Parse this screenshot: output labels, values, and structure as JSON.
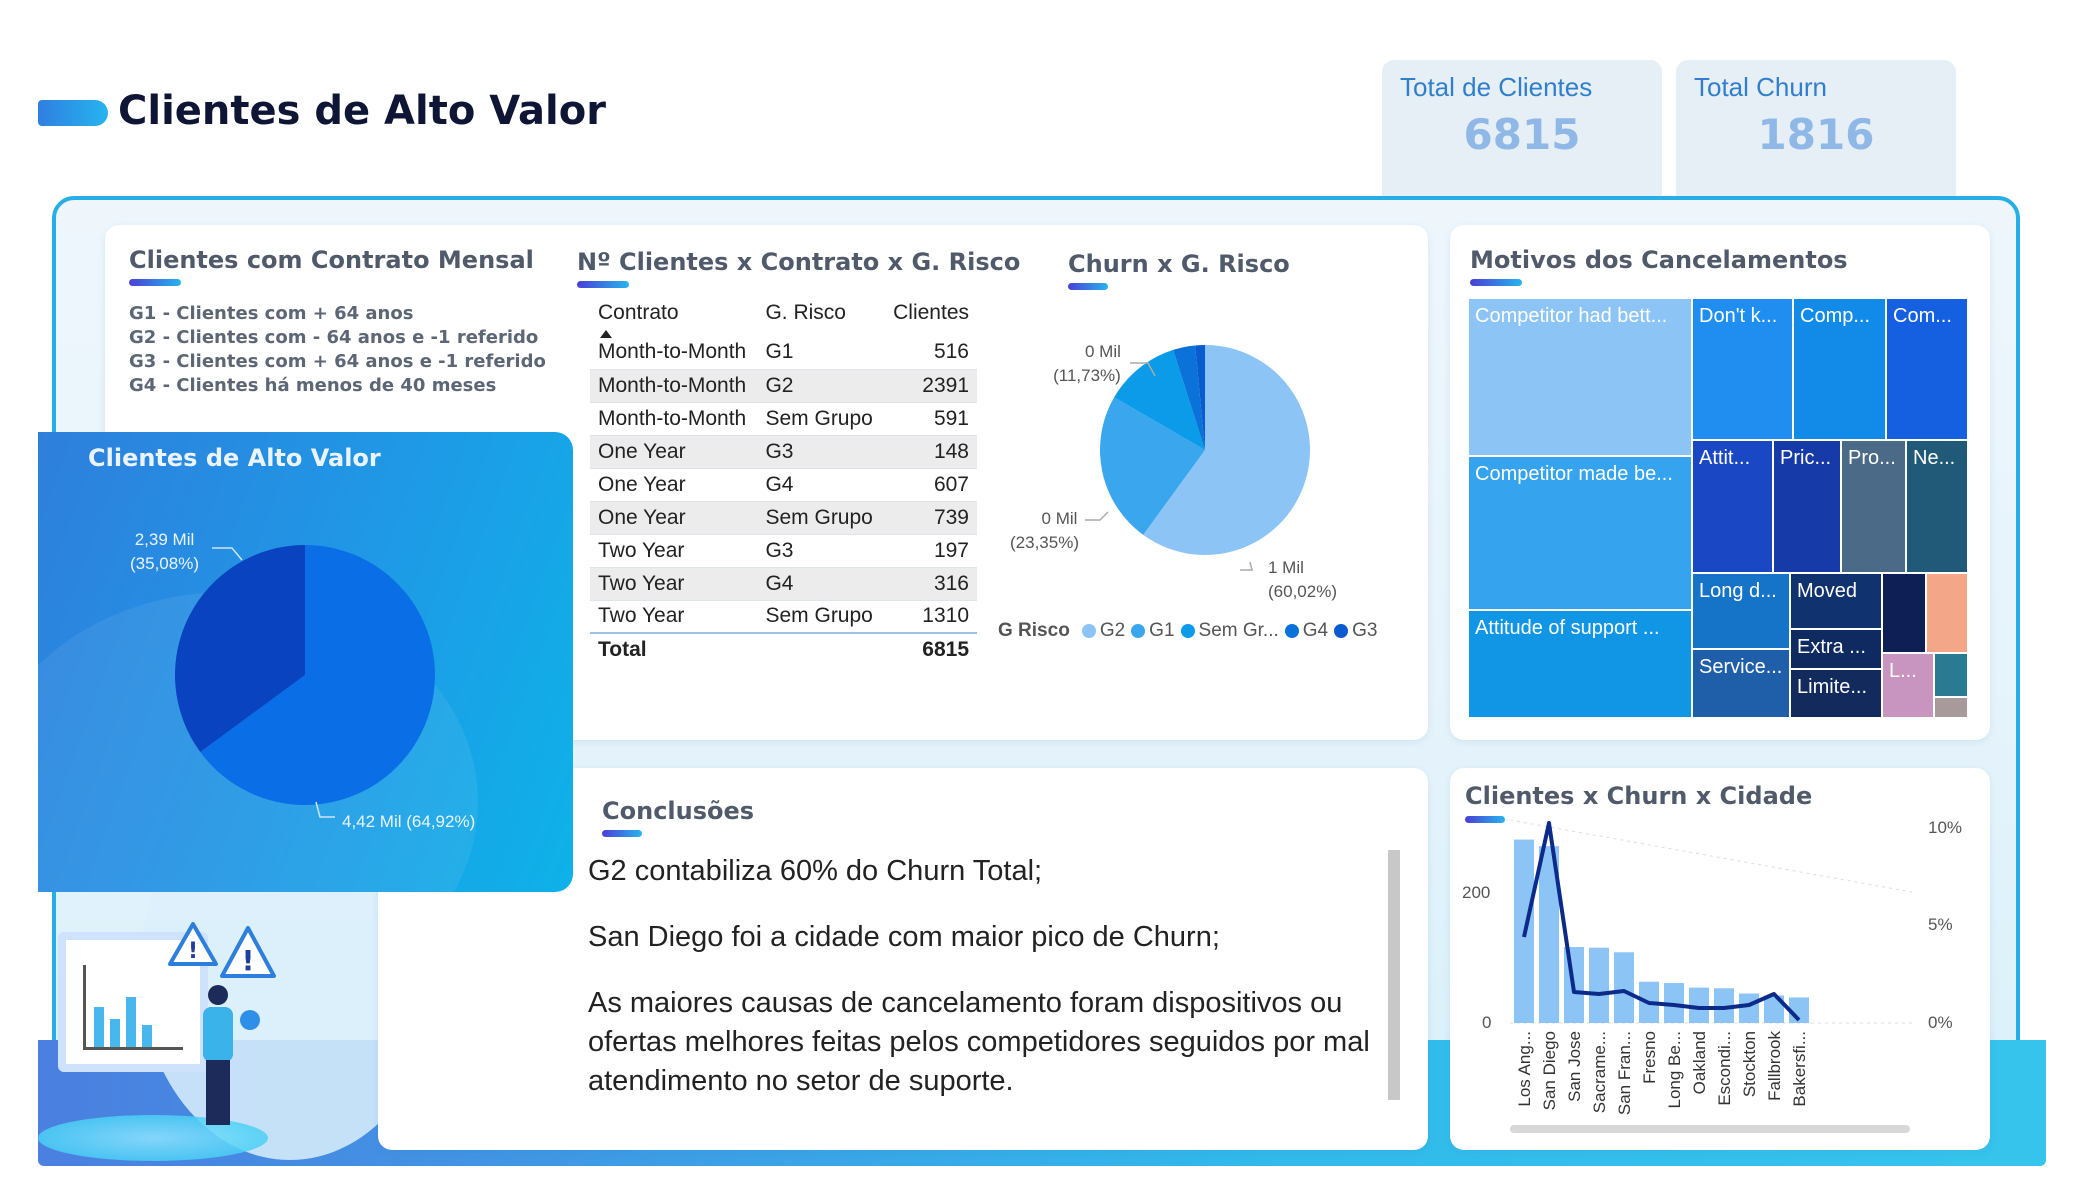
{
  "page": {
    "title": "Clientes de Alto Valor"
  },
  "kpis": [
    {
      "label": "Total de Clientes",
      "value": "6815"
    },
    {
      "label": "Total Churn",
      "value": "1816"
    }
  ],
  "mensal": {
    "title": "Clientes com Contrato Mensal",
    "groups": [
      "G1 - Clientes com + 64 anos",
      "G2 - Clientes com - 64 anos e -1 referido",
      "G3 - Clientes com + 64 anos e -1 referido",
      "G4 - Clientes há menos de 40 meses"
    ]
  },
  "alto_valor": {
    "title": "Clientes de Alto Valor",
    "label_a": "2,39 Mil",
    "label_a_pct": "(35,08%)",
    "label_b": "4,42 Mil (64,92%)"
  },
  "tabela": {
    "title": "Nº Clientes x Contrato x G. Risco",
    "headers": [
      "Contrato",
      "G. Risco",
      "Clientes"
    ],
    "rows": [
      [
        "Month-to-Month",
        "G1",
        "516"
      ],
      [
        "Month-to-Month",
        "G2",
        "2391"
      ],
      [
        "Month-to-Month",
        "Sem Grupo",
        "591"
      ],
      [
        "One Year",
        "G3",
        "148"
      ],
      [
        "One Year",
        "G4",
        "607"
      ],
      [
        "One Year",
        "Sem Grupo",
        "739"
      ],
      [
        "Two Year",
        "G3",
        "197"
      ],
      [
        "Two Year",
        "G4",
        "316"
      ],
      [
        "Two Year",
        "Sem Grupo",
        "1310"
      ]
    ],
    "total_label": "Total",
    "total_value": "6815"
  },
  "churn_risco": {
    "title": "Churn x G. Risco",
    "label_top": "0 Mil",
    "label_top_pct": "(11,73%)",
    "label_left": "0 Mil",
    "label_left_pct": "(23,35%)",
    "label_right": "1 Mil",
    "label_right_pct": "(60,02%)",
    "legend_title": "G Risco",
    "legend": [
      "G2",
      "G1",
      "Sem Gr...",
      "G4",
      "G3"
    ]
  },
  "motivos": {
    "title": "Motivos dos Cancelamentos",
    "cells": [
      "Competitor had bett...",
      "Don't k...",
      "Comp...",
      "Com...",
      "Competitor made be...",
      "Attit...",
      "Pric...",
      "Pro...",
      "Ne...",
      "Attitude of support ...",
      "Long d...",
      "Moved",
      "Extra ...",
      "Service...",
      "Limite...",
      "L..."
    ]
  },
  "conclusoes": {
    "title": "Conclusões",
    "items": [
      "G2 contabiliza 60% do Churn Total;",
      "San Diego foi a cidade com maior pico de Churn;",
      "As maiores causas de cancelamento foram dispositivos ou ofertas melhores feitas pelos competidores seguidos por mal atendimento no setor de suporte."
    ]
  },
  "cidade": {
    "title": "Clientes x Churn x Cidade",
    "left_ticks": [
      "200",
      "0"
    ],
    "right_ticks": [
      "10%",
      "5%",
      "0%"
    ]
  },
  "colors": {
    "accent_blue": "#1f86e0",
    "kpi_value": "#8fb8e6",
    "g2": "#8cc4f5",
    "g1": "#3aa6ee",
    "sem_grupo": "#0b9be8",
    "g4": "#0a72d8",
    "g3": "#0b5bd0"
  },
  "chart_data": [
    {
      "type": "pie",
      "title": "Clientes de Alto Valor",
      "values": [
        4420,
        2390
      ],
      "labels": [
        "4,42 Mil (64,92%)",
        "2,39 Mil (35,08%)"
      ]
    },
    {
      "type": "pie",
      "title": "Churn x G. Risco",
      "categories": [
        "G2",
        "G1",
        "Sem Grupo",
        "G4",
        "G3"
      ],
      "values": [
        60.02,
        23.35,
        11.73,
        3.4,
        1.5
      ]
    },
    {
      "type": "bar",
      "title": "Clientes x Churn x Cidade",
      "categories": [
        "Los Ang...",
        "San Diego",
        "San Jose",
        "Sacrame...",
        "San Fran...",
        "Fresno",
        "Long Be...",
        "Oakland",
        "Escondi...",
        "Stockton",
        "Fallbrook",
        "Bakersfi..."
      ],
      "values": [
        280,
        270,
        116,
        115,
        108,
        63,
        61,
        54,
        53,
        45,
        42,
        39
      ],
      "ylim": [
        0,
        300
      ],
      "line_values": [
        4.3,
        10.0,
        1.55,
        1.45,
        1.6,
        1.0,
        0.9,
        0.75,
        0.75,
        0.9,
        1.45,
        0.15
      ],
      "y2lim": [
        0,
        10
      ]
    }
  ]
}
